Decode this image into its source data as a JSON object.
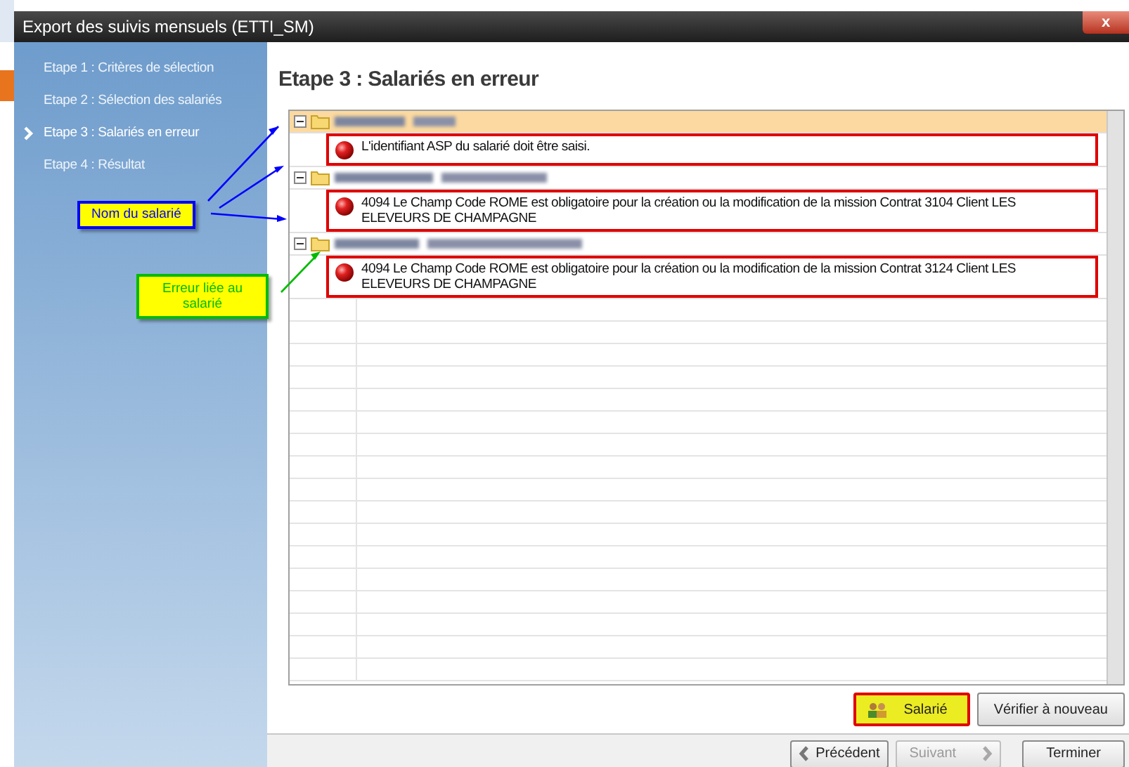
{
  "window": {
    "title": "Export des suivis mensuels (ETTI_SM)",
    "close_button": "x"
  },
  "steps": [
    {
      "label": "Etape 1 : Critères de sélection",
      "selected": false
    },
    {
      "label": "Etape 2 : Sélection des salariés",
      "selected": false
    },
    {
      "label": "Etape 3 : Salariés en erreur",
      "selected": true
    },
    {
      "label": "Etape 4 : Résultat",
      "selected": false
    }
  ],
  "heading": "Etape 3 : Salariés en erreur",
  "groups": [
    {
      "selected": true,
      "expanded": true,
      "errors": [
        {
          "text": "L'identifiant ASP du salarié doit être saisi.",
          "highlighted": true
        }
      ]
    },
    {
      "selected": false,
      "expanded": true,
      "errors": [
        {
          "text": "4094 Le Champ Code ROME est obligatoire pour la création ou la modification de la mission Contrat 3104 Client LES ELEVEURS DE CHAMPAGNE",
          "highlighted": true
        }
      ]
    },
    {
      "selected": false,
      "expanded": true,
      "errors": [
        {
          "text": "4094 Le Champ Code ROME est obligatoire pour la création ou la modification de la mission Contrat 3124 Client LES ELEVEURS DE CHAMPAGNE",
          "highlighted": true
        }
      ]
    }
  ],
  "action_buttons": [
    {
      "label": "Salarié",
      "highlighted": true,
      "kind": "icon"
    },
    {
      "label": "Vérifier à nouveau",
      "highlighted": false,
      "kind": "plain"
    }
  ],
  "nav_buttons": [
    {
      "label": "Précédent",
      "disabled": false,
      "default": false,
      "kind": "back"
    },
    {
      "label": "Suivant",
      "disabled": true,
      "default": false,
      "kind": "next"
    },
    {
      "label": "Terminer",
      "disabled": false,
      "default": true,
      "kind": "plain"
    }
  ],
  "annotations": [
    {
      "text": "Nom du salarié",
      "color": "#0000ff"
    },
    {
      "text": "Erreur liée au salarié",
      "color": "#00bb00"
    }
  ]
}
